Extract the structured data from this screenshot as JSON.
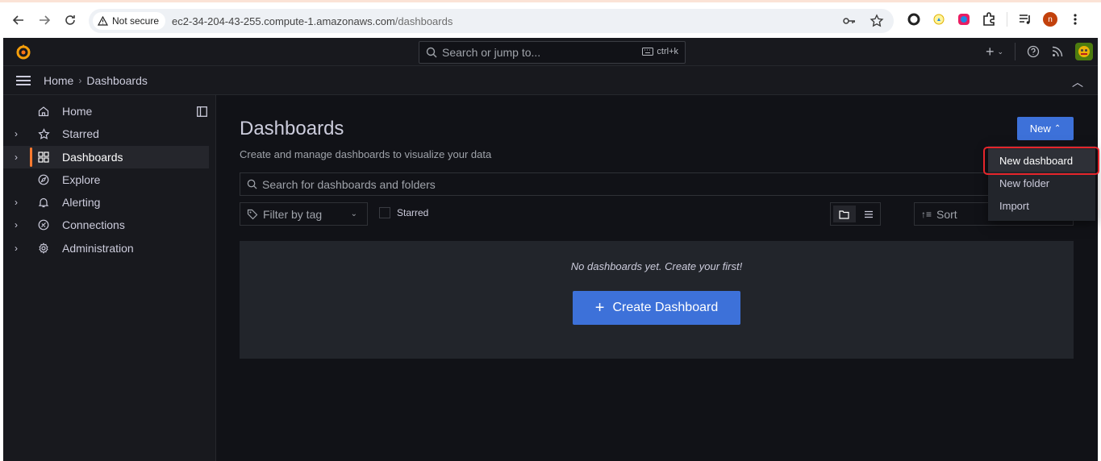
{
  "browser": {
    "security_label": "Not secure",
    "url_host": "ec2-34-204-43-255.compute-1.amazonaws.com",
    "url_path": "/dashboards",
    "profile_initial": "n"
  },
  "topbar": {
    "search_placeholder": "Search or jump to...",
    "search_shortcut": "ctrl+k"
  },
  "breadcrumb": {
    "home": "Home",
    "current": "Dashboards"
  },
  "sidebar": {
    "items": [
      {
        "label": "Home",
        "icon": "home-icon",
        "expandable": false,
        "active": false
      },
      {
        "label": "Starred",
        "icon": "star-icon",
        "expandable": true,
        "active": false
      },
      {
        "label": "Dashboards",
        "icon": "apps-icon",
        "expandable": true,
        "active": true
      },
      {
        "label": "Explore",
        "icon": "compass-icon",
        "expandable": false,
        "active": false
      },
      {
        "label": "Alerting",
        "icon": "bell-icon",
        "expandable": true,
        "active": false
      },
      {
        "label": "Connections",
        "icon": "plug-icon",
        "expandable": true,
        "active": false
      },
      {
        "label": "Administration",
        "icon": "cog-icon",
        "expandable": true,
        "active": false
      }
    ]
  },
  "main": {
    "title": "Dashboards",
    "subtitle": "Create and manage dashboards to visualize your data",
    "new_button": "New",
    "search_placeholder": "Search for dashboards and folders",
    "filter_tag": "Filter by tag",
    "starred_label": "Starred",
    "sort_label": "Sort",
    "empty_message": "No dashboards yet. Create your first!",
    "create_button": "Create Dashboard"
  },
  "new_menu": {
    "items": [
      "New dashboard",
      "New folder",
      "Import"
    ]
  },
  "colors": {
    "accent_blue": "#3d71d9",
    "active_bar": "#ff7a2f",
    "highlight_box": "#e5252b"
  }
}
